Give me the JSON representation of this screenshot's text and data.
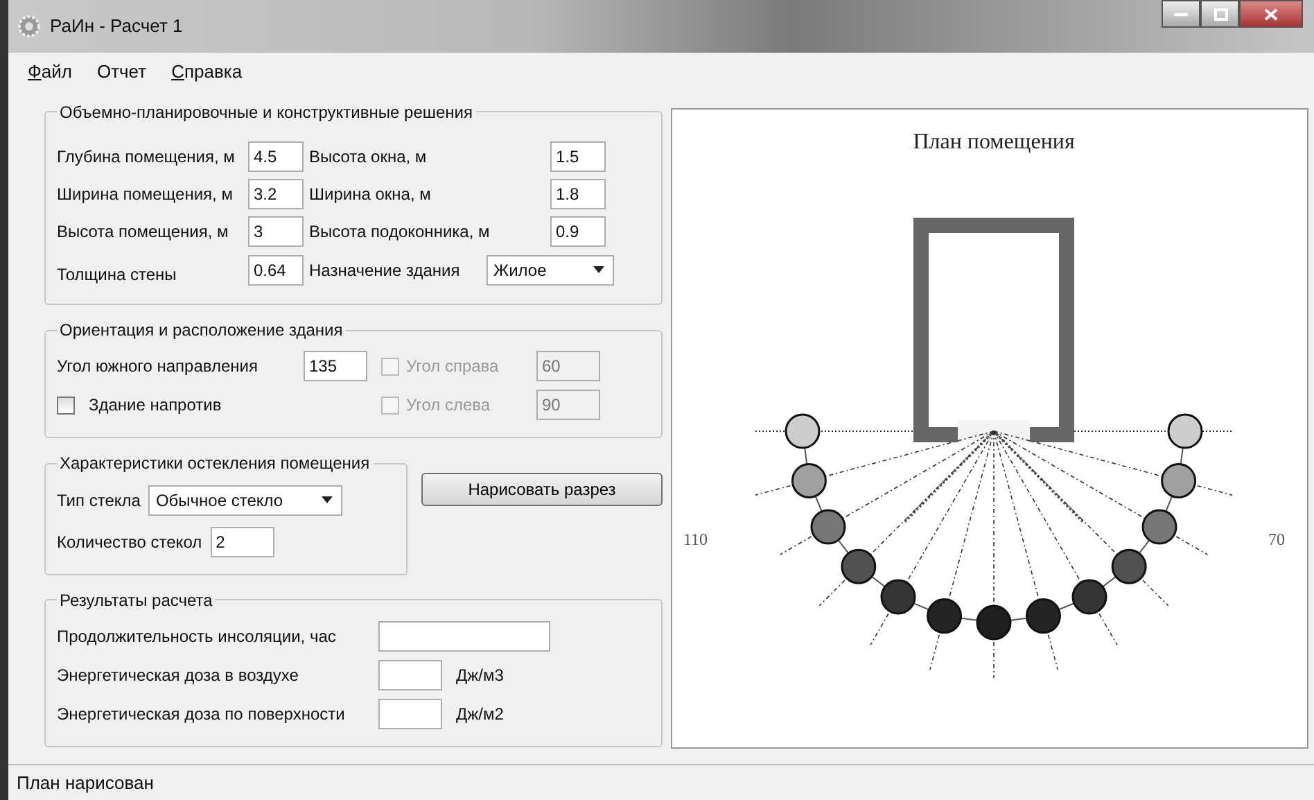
{
  "window": {
    "title": "РаИн - Расчет 1"
  },
  "menu": [
    {
      "label": "Файл",
      "mnemonic": true
    },
    {
      "label": "Отчет",
      "mnemonic": false
    },
    {
      "label": "Справка",
      "mnemonic": true
    }
  ],
  "dimensions": {
    "title": "Объемно-планировочные и конструктивные решения",
    "fields": [
      {
        "label": "Глубина помещения, м",
        "value": "4.5"
      },
      {
        "label": "Высота окна, м",
        "value": "1.5"
      },
      {
        "label": "Ширина помещения, м",
        "value": "3.2"
      },
      {
        "label": "Ширина окна, м",
        "value": "1.8"
      },
      {
        "label": "Высота помещения, м",
        "value": "3"
      },
      {
        "label": "Высота подоконника, м",
        "value": "0.9"
      },
      {
        "label": "Толщина стены",
        "value": "0.64"
      }
    ],
    "purpose": {
      "label": "Назначение здания",
      "value": "Жилое"
    }
  },
  "orientation": {
    "title": "Ориентация и расположение здания",
    "south_angle": {
      "label": "Угол южного направления",
      "value": "135"
    },
    "opposite_building": {
      "label": "Здание напротив",
      "checked": false
    },
    "angles": [
      {
        "label": "Угол справа",
        "checked": false,
        "disabled": true,
        "value": "60"
      },
      {
        "label": "Угол слева",
        "checked": false,
        "disabled": true,
        "value": "90"
      }
    ]
  },
  "glazing": {
    "title": "Характеристики остекления помещения",
    "glass_type": {
      "label": "Тип стекла",
      "value": "Обычное стекло"
    },
    "panes": {
      "label": "Количество стекол",
      "value": "2"
    }
  },
  "draw_button": "Нарисовать разрез",
  "results": {
    "title": "Результаты расчета",
    "rows": [
      {
        "label": "Продолжительность инсоляции, час"
      },
      {
        "label": "Энергетическая доза в воздухе",
        "unit": "Дж/м3"
      },
      {
        "label": "Энергетическая доза по поверхности",
        "unit": "Дж/м2"
      }
    ]
  },
  "plan": {
    "title": "План помещения",
    "left_label": "110",
    "right_label": "70"
  },
  "status_bar": "План нарисован"
}
